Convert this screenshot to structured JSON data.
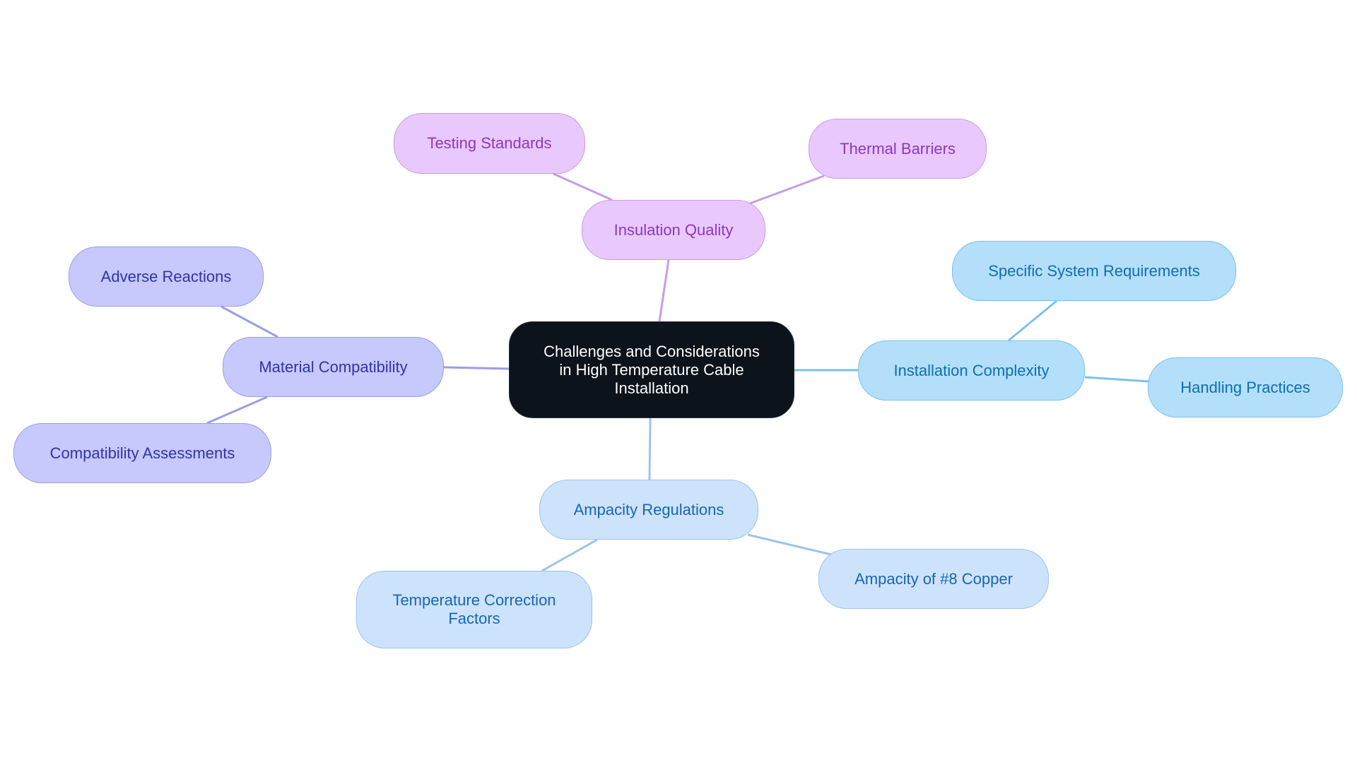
{
  "diagram": {
    "type": "mindmap",
    "colors": {
      "root_fill": "#0d131a",
      "root_text": "#ffffff",
      "purple_fill": "#e9c9fd",
      "purple_line": "#c99be8",
      "purple_text": "#8c38be",
      "indigo_fill": "#c7c9fd",
      "indigo_line": "#9a9de6",
      "indigo_text": "#2f34a8",
      "sky_fill": "#b3dffb",
      "sky_line": "#7fc0ea",
      "sky_text": "#0e6fb0",
      "blue_fill": "#cde3fb",
      "blue_line": "#9cc3ec",
      "blue_text": "#1866b4"
    },
    "root": {
      "label": "Challenges and Considerations in High Temperature Cable Installation",
      "lines": [
        "Challenges and Considerations",
        "in High Temperature Cable",
        "Installation"
      ]
    },
    "branches": [
      {
        "id": "insulation",
        "label": "Insulation Quality",
        "theme": "purple",
        "children": [
          {
            "id": "testing",
            "label": "Testing Standards"
          },
          {
            "id": "thermal",
            "label": "Thermal Barriers"
          }
        ]
      },
      {
        "id": "material",
        "label": "Material Compatibility",
        "theme": "indigo",
        "children": [
          {
            "id": "adverse",
            "label": "Adverse Reactions"
          },
          {
            "id": "assess",
            "label": "Compatibility Assessments"
          }
        ]
      },
      {
        "id": "install",
        "label": "Installation Complexity",
        "theme": "sky",
        "children": [
          {
            "id": "specific",
            "label": "Specific System Requirements"
          },
          {
            "id": "handling",
            "label": "Handling Practices"
          }
        ]
      },
      {
        "id": "ampacity",
        "label": "Ampacity Regulations",
        "theme": "blue",
        "children": [
          {
            "id": "tempcorr",
            "label": "Temperature Correction Factors",
            "lines": [
              "Temperature Correction",
              "Factors"
            ]
          },
          {
            "id": "copper",
            "label": "Ampacity of #8 Copper"
          }
        ]
      }
    ]
  }
}
